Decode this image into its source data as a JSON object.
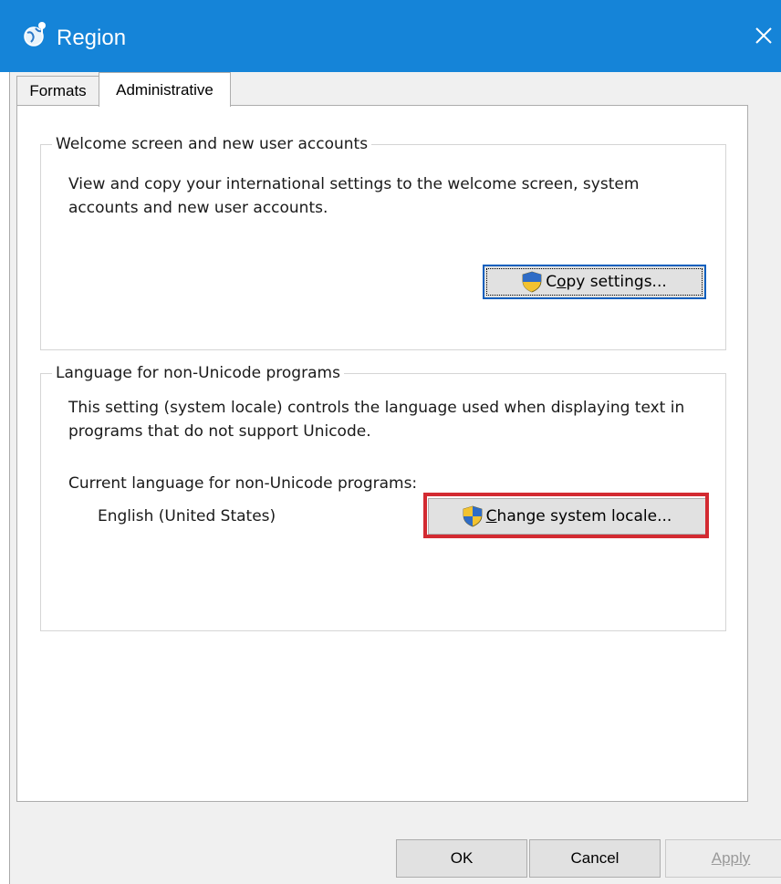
{
  "window": {
    "title": "Region",
    "title_icon": "region-globe-icon",
    "close_icon": "close-icon",
    "accent_color": "#1584d8"
  },
  "tabs": [
    {
      "label": "Formats",
      "selected": false
    },
    {
      "label": "Administrative",
      "selected": true
    }
  ],
  "welcome_group": {
    "title": "Welcome screen and new user accounts",
    "description": "View and copy your international settings to the welcome screen, system accounts and new user accounts.",
    "button": {
      "before": "C",
      "accel": "o",
      "after": "py settings...",
      "icon": "uac-shield-icon"
    }
  },
  "locale_group": {
    "title": "Language for non-Unicode programs",
    "description": "This setting (system locale) controls the language used when displaying text in programs that do not support Unicode.",
    "current_label": "Current language for non-Unicode programs:",
    "current_value": "English (United States)",
    "button": {
      "accel": "C",
      "after": "hange system locale...",
      "icon": "uac-shield-icon",
      "highlight_color": "#d32a31"
    }
  },
  "footer": {
    "ok": "OK",
    "cancel": "Cancel",
    "apply": "Apply",
    "apply_enabled": false
  }
}
